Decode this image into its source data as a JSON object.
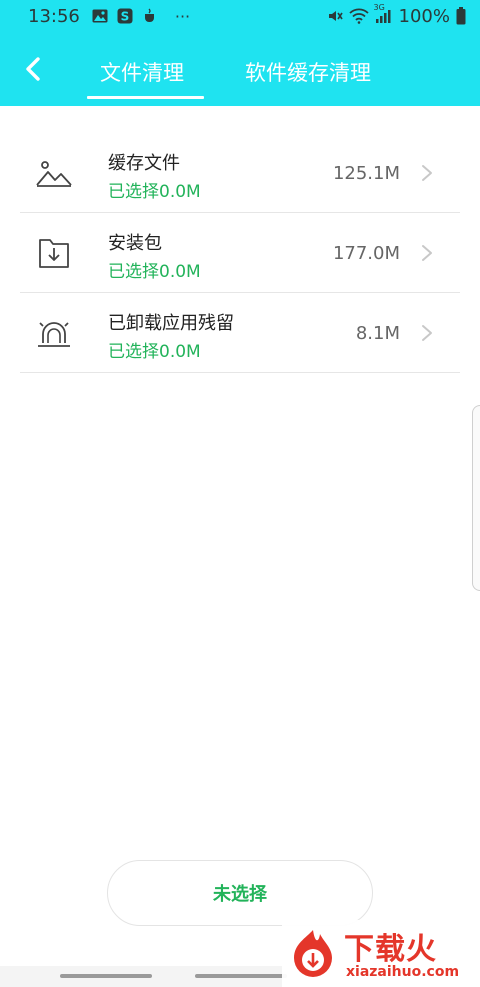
{
  "status_bar": {
    "time": "13:56",
    "left_icons": [
      "gallery-icon",
      "s-app-icon",
      "cup-icon",
      "more-dots-icon"
    ],
    "right_icons": [
      "mute-icon",
      "wifi-icon",
      "signal-icon"
    ],
    "more": "···",
    "network_label": "3G",
    "battery": "100%"
  },
  "header": {
    "back_icon": "chevron-left-icon",
    "tabs": [
      {
        "label": "文件清理",
        "active": true
      },
      {
        "label": "软件缓存清理",
        "active": false
      }
    ]
  },
  "items": [
    {
      "icon": "image-icon",
      "title": "缓存文件",
      "subtitle": "已选择0.0M",
      "size": "125.1M"
    },
    {
      "icon": "download-box-icon",
      "title": "安装包",
      "subtitle": "已选择0.0M",
      "size": "177.0M"
    },
    {
      "icon": "alarm-light-icon",
      "title": "已卸载应用残留",
      "subtitle": "已选择0.0M",
      "size": "8.1M"
    }
  ],
  "bottom_button": {
    "label": "未选择"
  },
  "watermark": {
    "title": "下载火",
    "url": "xiazaihuo.com"
  },
  "colors": {
    "header_bg": "#1fe3f0",
    "accent_green": "#22b35a",
    "watermark_red": "#e4362a"
  }
}
